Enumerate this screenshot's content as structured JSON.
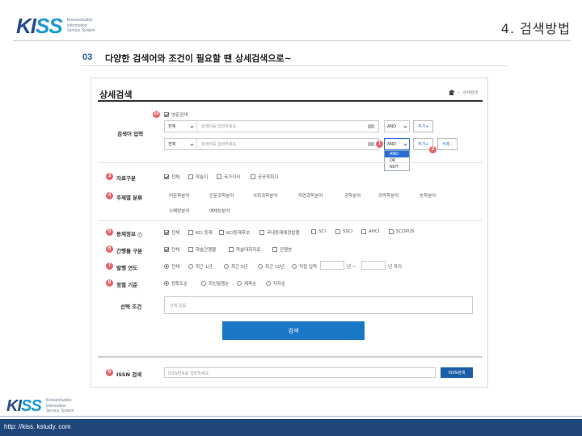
{
  "header": {
    "logo_k": "KI",
    "logo_ss": "SS",
    "logo_tagline": "Koreanstudies\nInformation\nService System",
    "slide_title": "4. 검색방법"
  },
  "step": {
    "number": "03",
    "text": "다양한 검색어와 조건이 필요할 땐 상세검색으로~"
  },
  "panel": {
    "title": "상세검색",
    "breadcrumb": "상세검색",
    "query": {
      "badge": "10",
      "option_label": "영문검색",
      "label": "검색어 입력",
      "rows": [
        {
          "field": "전체",
          "placeholder": "검색어를 입력하세요.",
          "operator": "AND",
          "add": "추가+"
        },
        {
          "field": "전체",
          "placeholder": "검색어를 입력하세요.",
          "operator": "AND",
          "add": "추가+",
          "remove": "삭제 -"
        }
      ],
      "operator_menu": [
        "AND",
        "OR",
        "NOT"
      ],
      "badge_1": "1",
      "badge_2": "2"
    },
    "data_type": {
      "badge": "3",
      "label": "자료구분",
      "options": [
        {
          "label": "전체",
          "checked": true
        },
        {
          "label": "학술지",
          "checked": false
        },
        {
          "label": "국가지식",
          "checked": false
        },
        {
          "label": "공공학회지",
          "checked": false
        }
      ]
    },
    "subject": {
      "badge": "4",
      "label": "주제별 분류",
      "items": [
        "어문학분야",
        "인문과학분야",
        "사회과학분야",
        "자연과학분야",
        "공학분야",
        "의약학분야",
        "농학분야",
        "수해양분야",
        "예체능분야"
      ]
    },
    "index": {
      "badge": "5",
      "label": "등재정보",
      "help": "?",
      "options": [
        {
          "label": "전체",
          "checked": true
        },
        {
          "label": "KCI 등재",
          "checked": false
        },
        {
          "label": "KCI등재후보",
          "checked": false
        },
        {
          "label": "국내등재예정발행",
          "checked": false
        },
        {
          "label": "SCI",
          "checked": false
        },
        {
          "label": "SSCI",
          "checked": false
        },
        {
          "label": "AHCI",
          "checked": false
        },
        {
          "label": "SCOPUS",
          "checked": false
        }
      ]
    },
    "publisher": {
      "badge": "6",
      "label": "간행물 구분",
      "options": [
        {
          "label": "전체",
          "checked": true
        },
        {
          "label": "학술간행물",
          "checked": false
        },
        {
          "label": "학술대회자료",
          "checked": false
        },
        {
          "label": "단행본",
          "checked": false
        }
      ]
    },
    "year": {
      "badge": "7",
      "label": "발행 연도",
      "options": [
        {
          "label": "전체",
          "checked": true
        },
        {
          "label": "최근 1년",
          "checked": false
        },
        {
          "label": "최근 5년",
          "checked": false
        },
        {
          "label": "최근 10년",
          "checked": false
        },
        {
          "label": "직접 입력",
          "checked": false
        }
      ],
      "from_suffix": "년 ~",
      "to_suffix": "년 까지"
    },
    "sort": {
      "badge": "8",
      "label": "정렬 기준",
      "options": [
        {
          "label": "정확도순",
          "checked": true
        },
        {
          "label": "최신발행순",
          "checked": false
        },
        {
          "label": "제목순",
          "checked": false
        },
        {
          "label": "저자순",
          "checked": false
        }
      ]
    },
    "condition": {
      "label": "선택 조건",
      "placeholder": "선택 없음"
    },
    "search_button": "검색",
    "issn": {
      "badge": "9",
      "label": "ISSN 검색",
      "placeholder": "ISSN번호를 입력하세요.",
      "button": "ISSN검색"
    }
  },
  "footer": {
    "url": "http: //kiss. kstudy. com",
    "logo_tagline": "Koreanstudies\nInformation\nService System"
  },
  "colors": {
    "brand_navy": "#1f4679",
    "badge_red": "#e76468",
    "button_blue": "#1b78c7"
  }
}
